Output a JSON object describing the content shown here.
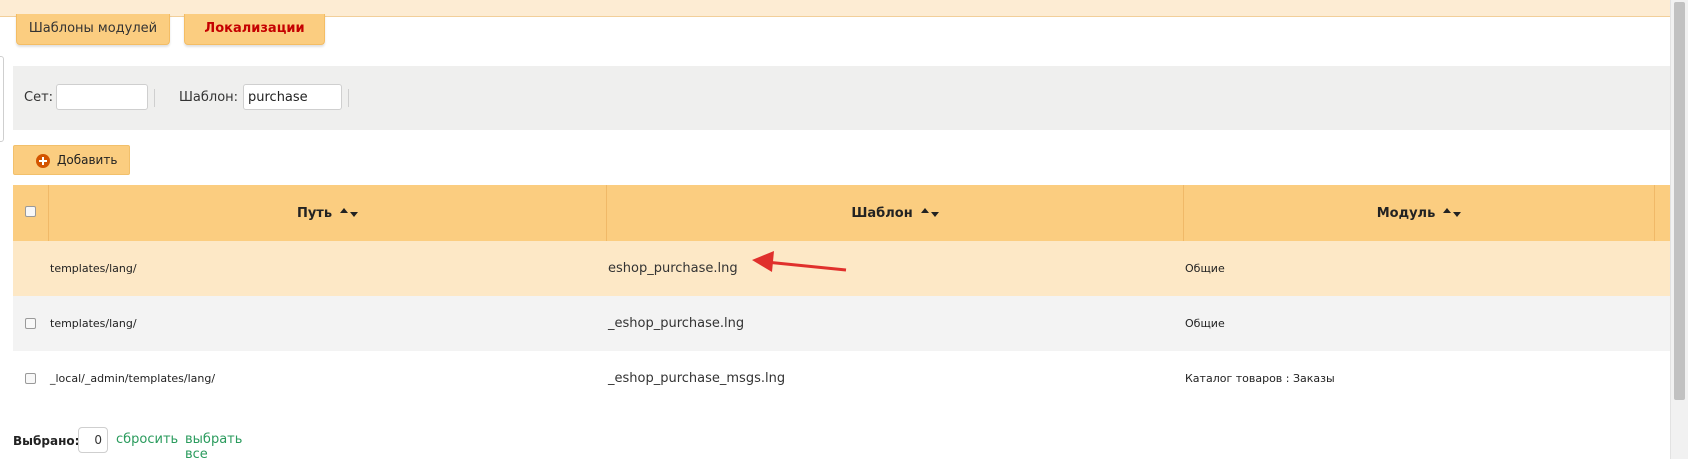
{
  "tabs": [
    {
      "label": "Шаблоны модулей"
    },
    {
      "label": "Локализации"
    }
  ],
  "filters": {
    "set_label": "Сет:",
    "set_value": "",
    "template_label": "Шаблон:",
    "template_value": "purchase"
  },
  "toolbar": {
    "add_label": "Добавить"
  },
  "table": {
    "headers": [
      "Путь",
      "Шаблон",
      "Модуль"
    ],
    "rows": [
      {
        "path": "templates/lang/",
        "template": "eshop_purchase.lng",
        "module": "Общие"
      },
      {
        "path": "templates/lang/",
        "template": "_eshop_purchase.lng",
        "module": "Общие"
      },
      {
        "path": "_local/_admin/templates/lang/",
        "template": "_eshop_purchase_msgs.lng",
        "module": "Каталог товаров : Заказы"
      }
    ]
  },
  "footer": {
    "selected_label": "Выбрано:",
    "selected_count": "0",
    "reset_label": "сбросить",
    "select_all_label": "выбрать все"
  },
  "colors": {
    "accent": "#fbcd80",
    "active_tab_text": "#c50000",
    "highlight_row": "#fde8c6",
    "link": "#2a9b5d",
    "annotation_arrow": "#e0302c"
  }
}
